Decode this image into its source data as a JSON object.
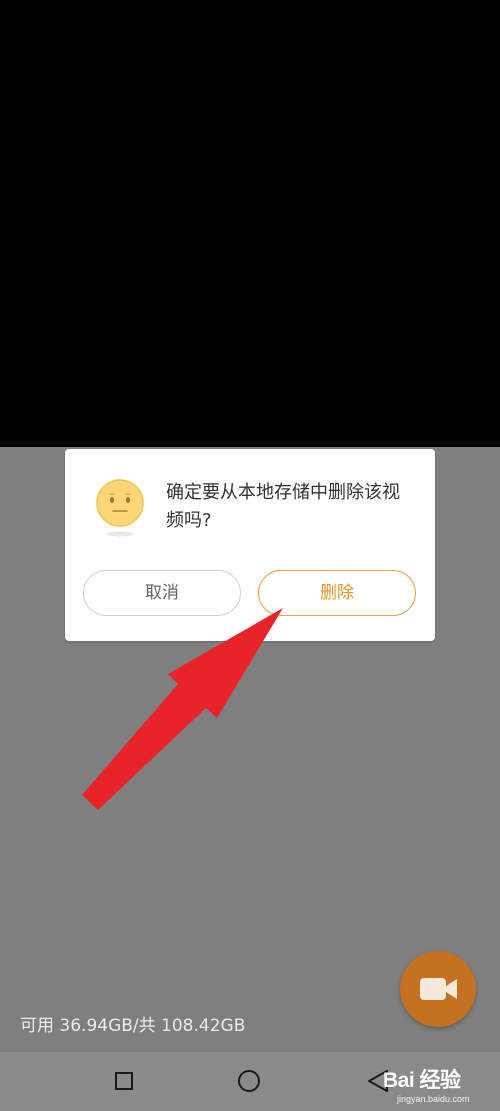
{
  "dialog": {
    "message": "确定要从本地存储中删除该视频吗?",
    "cancel_label": "取消",
    "delete_label": "删除"
  },
  "storage": {
    "text": "可用 36.94GB/共 108.42GB"
  },
  "fab": {
    "icon": "video-camera-icon"
  },
  "navbar": {
    "recent_icon": "square-icon",
    "home_icon": "circle-icon",
    "back_icon": "triangle-back-icon"
  },
  "watermark": {
    "brand": "Bai 经验",
    "url": "jingyan.baidu.com"
  },
  "colors": {
    "accent": "#e6952c",
    "fab_bg": "#c47120",
    "overlay": "#7f7f7f",
    "arrow": "#e8232a"
  }
}
